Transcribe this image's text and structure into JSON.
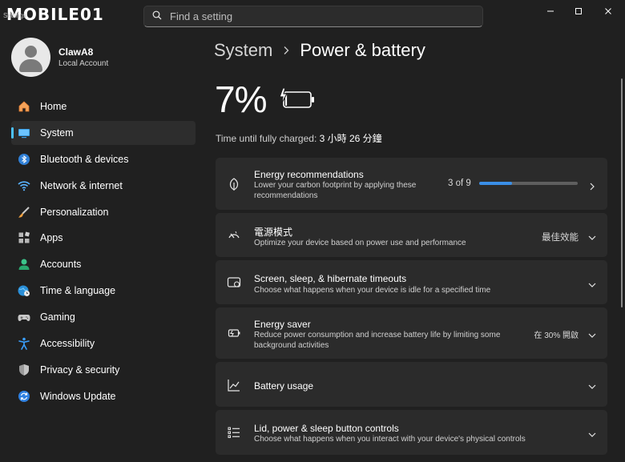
{
  "window": {
    "logo_text": "MOBILE01",
    "app_title": "Settings",
    "controls": [
      "minimize",
      "maximize",
      "close"
    ]
  },
  "search": {
    "placeholder": "Find a setting"
  },
  "profile": {
    "name": "ClawA8",
    "account_type": "Local Account"
  },
  "sidebar": {
    "items": [
      {
        "label": "Home",
        "icon": "home-icon",
        "active": false
      },
      {
        "label": "System",
        "icon": "system-icon",
        "active": true
      },
      {
        "label": "Bluetooth & devices",
        "icon": "bluetooth-icon",
        "active": false
      },
      {
        "label": "Network & internet",
        "icon": "wifi-icon",
        "active": false
      },
      {
        "label": "Personalization",
        "icon": "brush-icon",
        "active": false
      },
      {
        "label": "Apps",
        "icon": "apps-icon",
        "active": false
      },
      {
        "label": "Accounts",
        "icon": "accounts-icon",
        "active": false
      },
      {
        "label": "Time & language",
        "icon": "time-language-icon",
        "active": false
      },
      {
        "label": "Gaming",
        "icon": "gamepad-icon",
        "active": false
      },
      {
        "label": "Accessibility",
        "icon": "accessibility-icon",
        "active": false
      },
      {
        "label": "Privacy & security",
        "icon": "shield-icon",
        "active": false
      },
      {
        "label": "Windows Update",
        "icon": "update-icon",
        "active": false
      }
    ]
  },
  "breadcrumb": {
    "parent": "System",
    "current": "Power & battery"
  },
  "battery": {
    "percent_label": "7%",
    "percent": 7,
    "charging": true,
    "time_label": "Time until fully charged:",
    "time_value": "3 小時 26 分鐘"
  },
  "cards": {
    "energy": {
      "title": "Energy recommendations",
      "desc": "Lower your carbon footprint by applying these recommendations",
      "count": "3 of 9",
      "progress": 0.33
    },
    "power_mode": {
      "title": "電源模式",
      "desc": "Optimize your device based on power use and performance",
      "value": "最佳效能"
    },
    "timeouts": {
      "title": "Screen, sleep, & hibernate timeouts",
      "desc": "Choose what happens when your device is idle for a specified time"
    },
    "energy_saver": {
      "title": "Energy saver",
      "desc": "Reduce power consumption and increase battery life by limiting some background activities",
      "value": "在 30% 開啟"
    },
    "battery_usage": {
      "title": "Battery usage"
    },
    "lid": {
      "title": "Lid, power & sleep button controls",
      "desc": "Choose what happens when you interact with your device's physical controls"
    }
  },
  "colors": {
    "accent": "#4cc2ff",
    "progress": "#3a8ee6",
    "card_bg": "#2b2b2b",
    "window_bg": "#202020"
  }
}
